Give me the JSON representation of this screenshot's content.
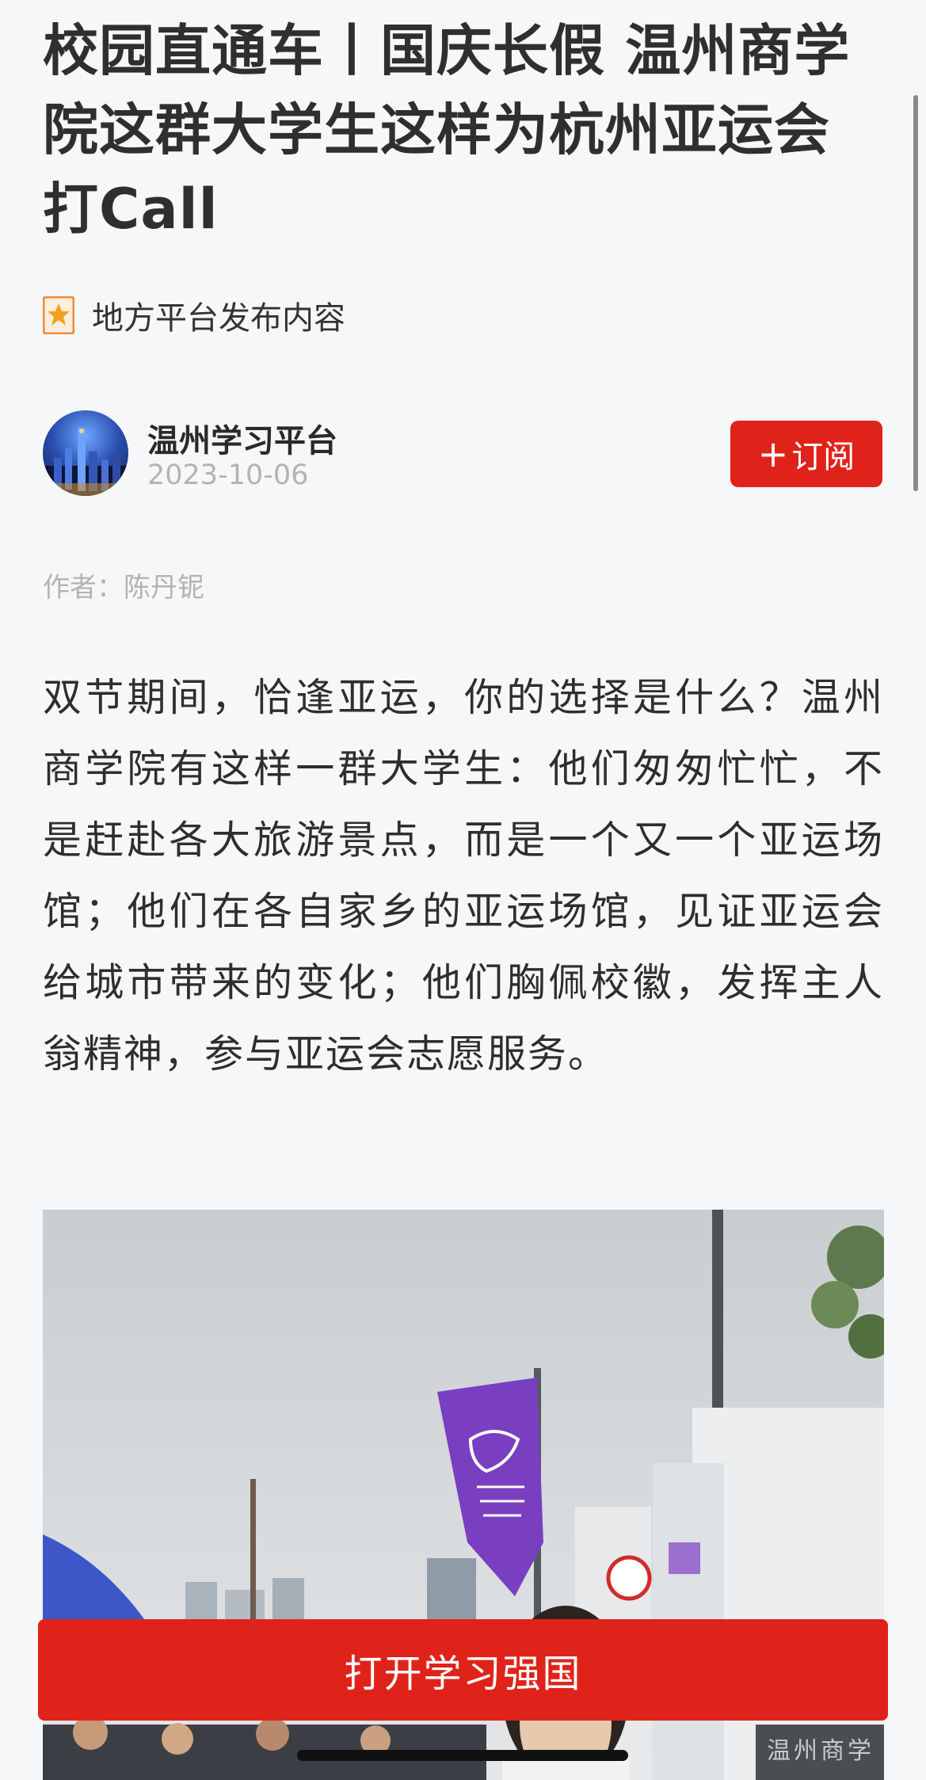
{
  "article": {
    "title": "校园直通车丨国庆长假 温州商学院这群大学生这样为杭州亚运会打Call",
    "source_label": "地方平台发布内容",
    "source_icon": "bookmark-star-icon",
    "channel": {
      "name": "温州学习平台",
      "date": "2023-10-06",
      "subscribe_label": "订阅",
      "subscribe_icon": "plus-icon"
    },
    "author_line": "作者：陈丹铌",
    "body": "双节期间，恰逢亚运，你的选择是什么？温州商学院有这样一群大学生：他们匆匆忙忙，不是赶赴各大旅游景点，而是一个又一个亚运场馆；他们在各自家乡的亚运场馆，见证亚运会给城市带来的变化；他们胸佩校徽，发挥主人翁精神，参与亚运会志愿服务。",
    "photo_watermark": "温州商学"
  },
  "bottom_bar": {
    "open_app_label": "打开学习强国"
  },
  "colors": {
    "accent": "#e0231a",
    "background": "#f6f7f9",
    "muted_text": "#b3b3b3",
    "banner_purple": "#7a3fc0"
  }
}
